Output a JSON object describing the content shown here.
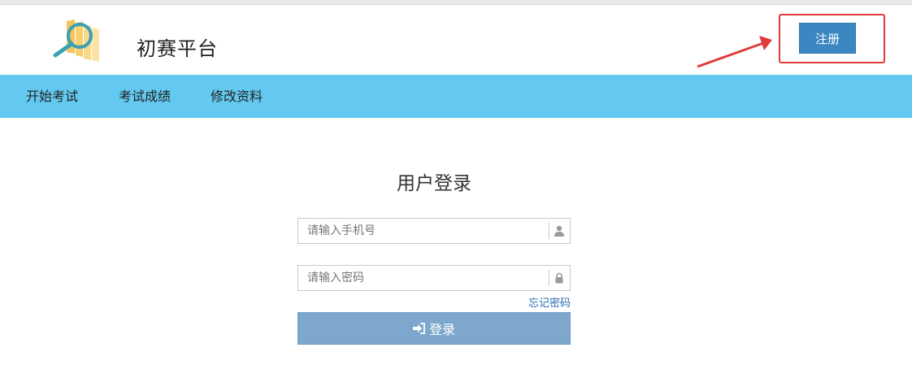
{
  "header": {
    "site_title": "初赛平台",
    "register_label": "注册"
  },
  "nav": {
    "items": [
      {
        "label": "开始考试"
      },
      {
        "label": "考试成绩"
      },
      {
        "label": "修改资料"
      }
    ]
  },
  "login": {
    "title": "用户登录",
    "phone_placeholder": "请输入手机号",
    "password_placeholder": "请输入密码",
    "forgot_label": "忘记密码",
    "submit_label": "登录"
  },
  "colors": {
    "nav_bg": "#63c9f0",
    "register_bg": "#3a87c2",
    "login_button_bg": "#7da7cc",
    "annotation": "#e23b3b"
  },
  "icons": {
    "phone_field": "user-icon",
    "password_field": "lock-icon",
    "login_button": "sign-in-icon",
    "logo": "magnifier-chart-logo-icon"
  }
}
